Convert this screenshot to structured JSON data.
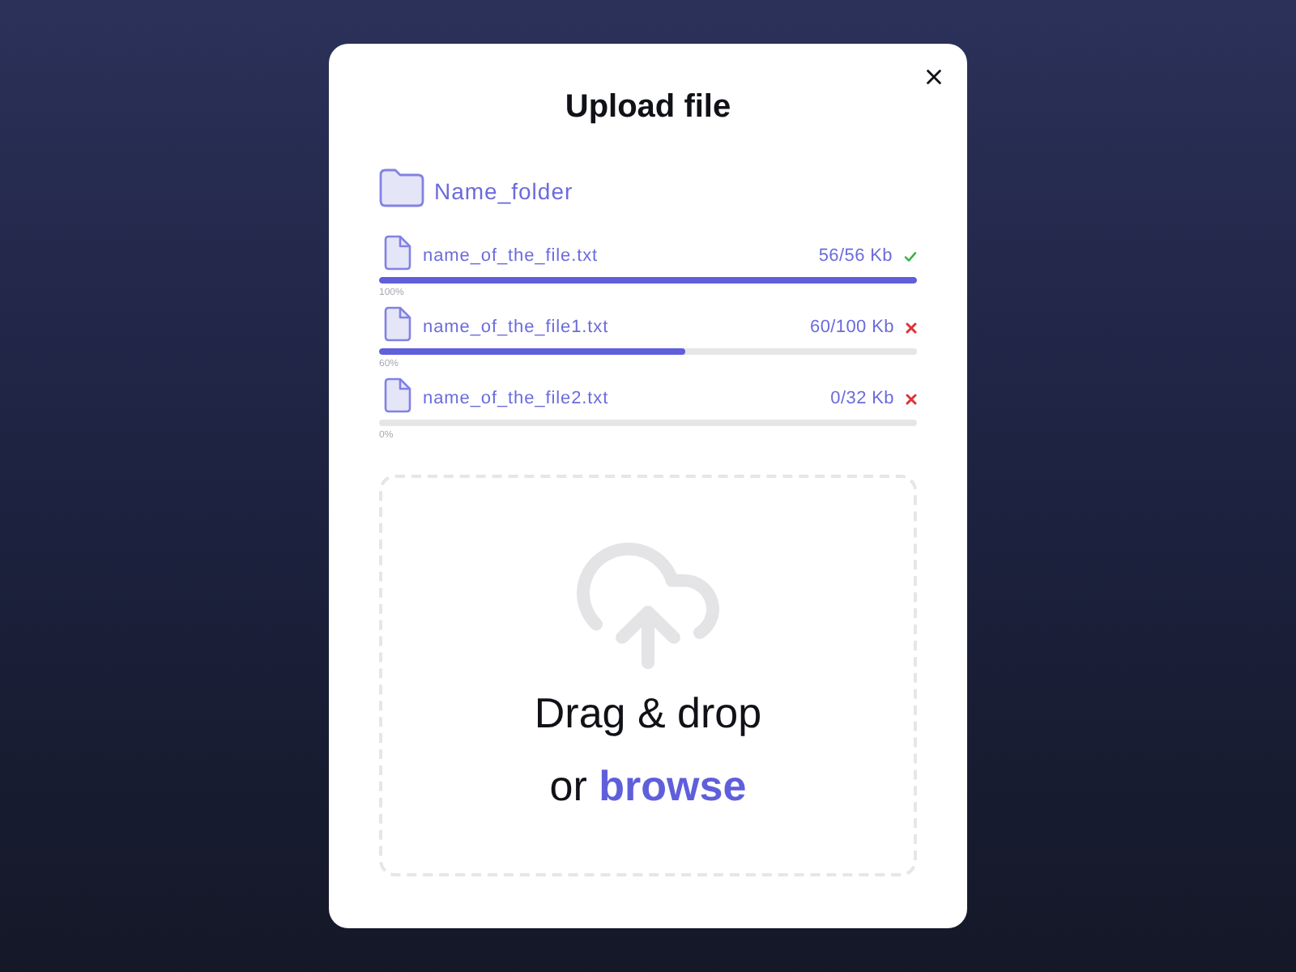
{
  "dialog": {
    "title": "Upload file"
  },
  "folder": {
    "name": "Name_folder"
  },
  "files": [
    {
      "name": "name_of_the_file.txt",
      "size": "56/56 Kb",
      "kind": "done",
      "level": 1,
      "percent": "100%"
    },
    {
      "name": "name_of_the_file1.txt",
      "size": "60/100 Kb",
      "kind": "error",
      "level": 0.57,
      "percent": "60%"
    },
    {
      "name": "name_of_the_file2.txt",
      "size": "0/32 Kb",
      "kind": "error",
      "level": 0,
      "percent": "0%"
    }
  ],
  "dropzone": {
    "text": "Drag & drop",
    "prompt": "or",
    "link": "browse"
  }
}
